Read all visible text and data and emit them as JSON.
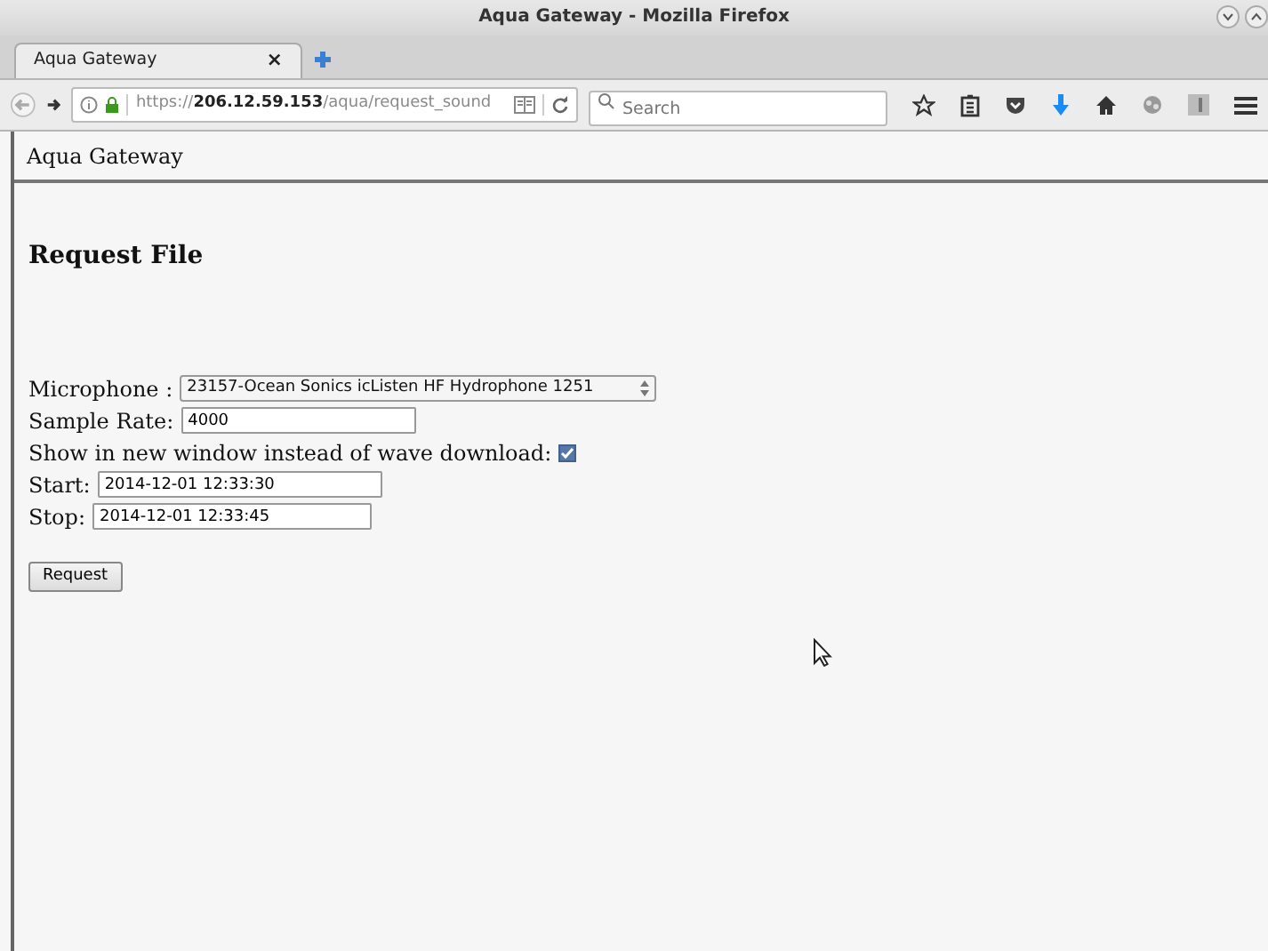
{
  "window": {
    "title": "Aqua Gateway - Mozilla Firefox"
  },
  "tabs": [
    {
      "label": "Aqua Gateway",
      "selected": true,
      "close": "×"
    }
  ],
  "toolbar": {
    "url": "https://**206.12.59.153**/aqua/request_sound",
    "search_placeholder": "Search"
  },
  "page": {
    "header": "Aqua Gateway",
    "heading": "Request File",
    "fields": [
      {
        "kind": "select",
        "label": "Microphone :",
        "value": "23157-Ocean Sonics icListen HF Hydrophone 1251"
      },
      {
        "kind": "text",
        "label": "Sample Rate:",
        "value": "4000"
      },
      {
        "kind": "checkbox",
        "label": "Show in new window instead of wave download:",
        "checked": true
      },
      {
        "kind": "text",
        "label": "Start:",
        "value": "2014-12-01 12:33:30"
      },
      {
        "kind": "text",
        "label": "Stop:",
        "value": "2014-12-01 12:33:45"
      }
    ],
    "button": "Request"
  }
}
